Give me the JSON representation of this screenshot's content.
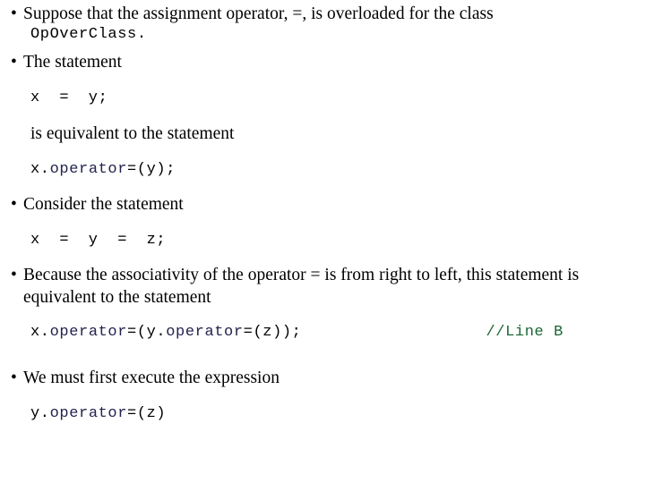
{
  "slide": {
    "background_color": "#ffffff",
    "text_color": "#000000",
    "code_color": "#232350",
    "comment_color": "#1a6633",
    "bullet_glyph": "bullet-dot"
  },
  "blocks": {
    "bullet1": "Suppose that the assignment operator, =, is overloaded for the class",
    "code1": "OpOverClass.",
    "bullet2": "The statement",
    "code2": "x  =  y;",
    "prose1": "is equivalent to the statement",
    "code3_pre": "x.",
    "code3_kw": "operator",
    "code3_post": "=(y);",
    "bullet3": "Consider the statement",
    "code4": "x  =  y  =  z;",
    "bullet4": "Because the associativity of the operator = is from right to left, this statement is equivalent to the statement",
    "code5_pre": "x.",
    "code5_kw1": "operator",
    "code5_mid": "=(y.",
    "code5_kw2": "operator",
    "code5_post": "=(z));",
    "comment5": "//Line B",
    "bullet5": "We must first execute the expression",
    "code6_pre": "y.",
    "code6_kw": "operator",
    "code6_post": "=(z)"
  }
}
